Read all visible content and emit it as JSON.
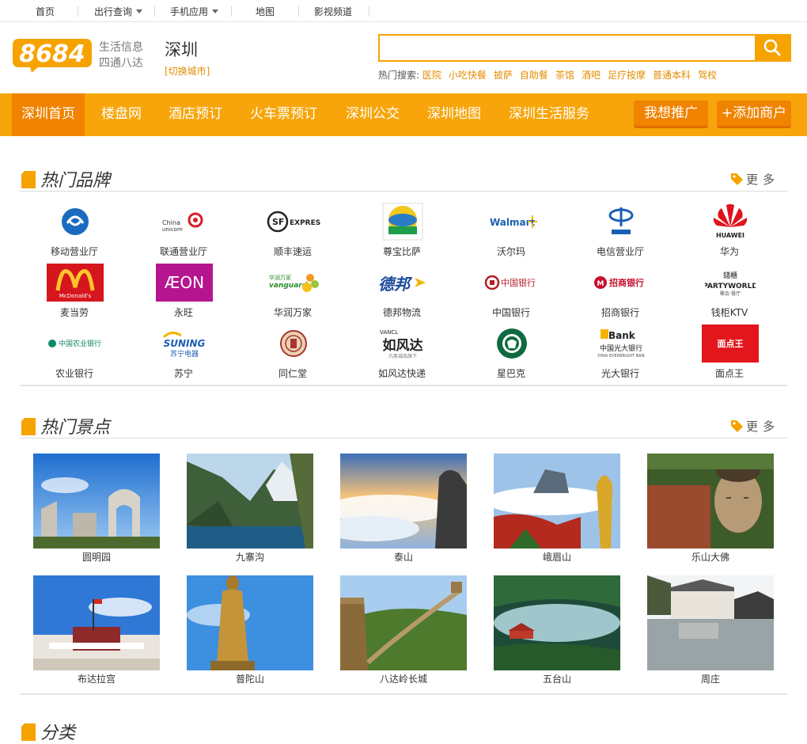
{
  "topbar": {
    "items": [
      "首页",
      "出行查询",
      "手机应用",
      "地图",
      "影视频道"
    ]
  },
  "header": {
    "logo_text": "8684",
    "slogan_line1": "生活信息",
    "slogan_line2": "四通八达",
    "city": "深圳",
    "switch_city": "[切换城市]",
    "search_placeholder": "",
    "hot_search_label": "热门搜索:",
    "hot_keywords": [
      "医院",
      "小吃快餐",
      "披萨",
      "自助餐",
      "茶馆",
      "酒吧",
      "足疗按摩",
      "普通本科",
      "驾校"
    ]
  },
  "nav": {
    "items": [
      "深圳首页",
      "楼盘网",
      "酒店预订",
      "火车票预订",
      "深圳公交",
      "深圳地图",
      "深圳生活服务"
    ],
    "promote_button": "我想推广",
    "add_merchant_button": "+添加商户"
  },
  "brands_section": {
    "title": "热门品牌",
    "more": "更多",
    "brands": [
      {
        "name": "移动营业厅",
        "logo_text": ""
      },
      {
        "name": "联通营业厅",
        "logo_text": "China unicom中国联通"
      },
      {
        "name": "顺丰速运",
        "logo_text": "EXPRESS"
      },
      {
        "name": "尊宝比萨",
        "logo_text": ""
      },
      {
        "name": "沃尔玛",
        "logo_text": "Walmart"
      },
      {
        "name": "电信营业厅",
        "logo_text": "中国电信"
      },
      {
        "name": "华为",
        "logo_text": "HUAWEI"
      },
      {
        "name": "麦当劳",
        "logo_text": "McDonald's"
      },
      {
        "name": "永旺",
        "logo_text": "ÆON"
      },
      {
        "name": "华润万家",
        "logo_text": "vanguard"
      },
      {
        "name": "德邦物流",
        "logo_text": "德邦"
      },
      {
        "name": "中国银行",
        "logo_text": "中国银行"
      },
      {
        "name": "招商银行",
        "logo_text": "招商银行"
      },
      {
        "name": "钱柜KTV",
        "logo_text": "PARTYWORLD"
      },
      {
        "name": "农业银行",
        "logo_text": "中国农业银行"
      },
      {
        "name": "苏宁",
        "logo_text": "SUNING"
      },
      {
        "name": "同仁堂",
        "logo_text": ""
      },
      {
        "name": "如风达快递",
        "logo_text": "如风达"
      },
      {
        "name": "星巴克",
        "logo_text": ""
      },
      {
        "name": "光大银行",
        "logo_text": "Bank"
      },
      {
        "name": "面点王",
        "logo_text": "面点王"
      }
    ]
  },
  "scenic_section": {
    "title": "热门景点",
    "more": "更多",
    "spots": [
      "圆明园",
      "九寨沟",
      "泰山",
      "峨眉山",
      "乐山大佛",
      "布达拉宫",
      "普陀山",
      "八达岭长城",
      "五台山",
      "周庄"
    ]
  },
  "category_section": {
    "title": "分类"
  },
  "colors": {
    "accent": "#f7a50a",
    "accent_dark": "#f08300",
    "link_orange": "#e38d00"
  }
}
